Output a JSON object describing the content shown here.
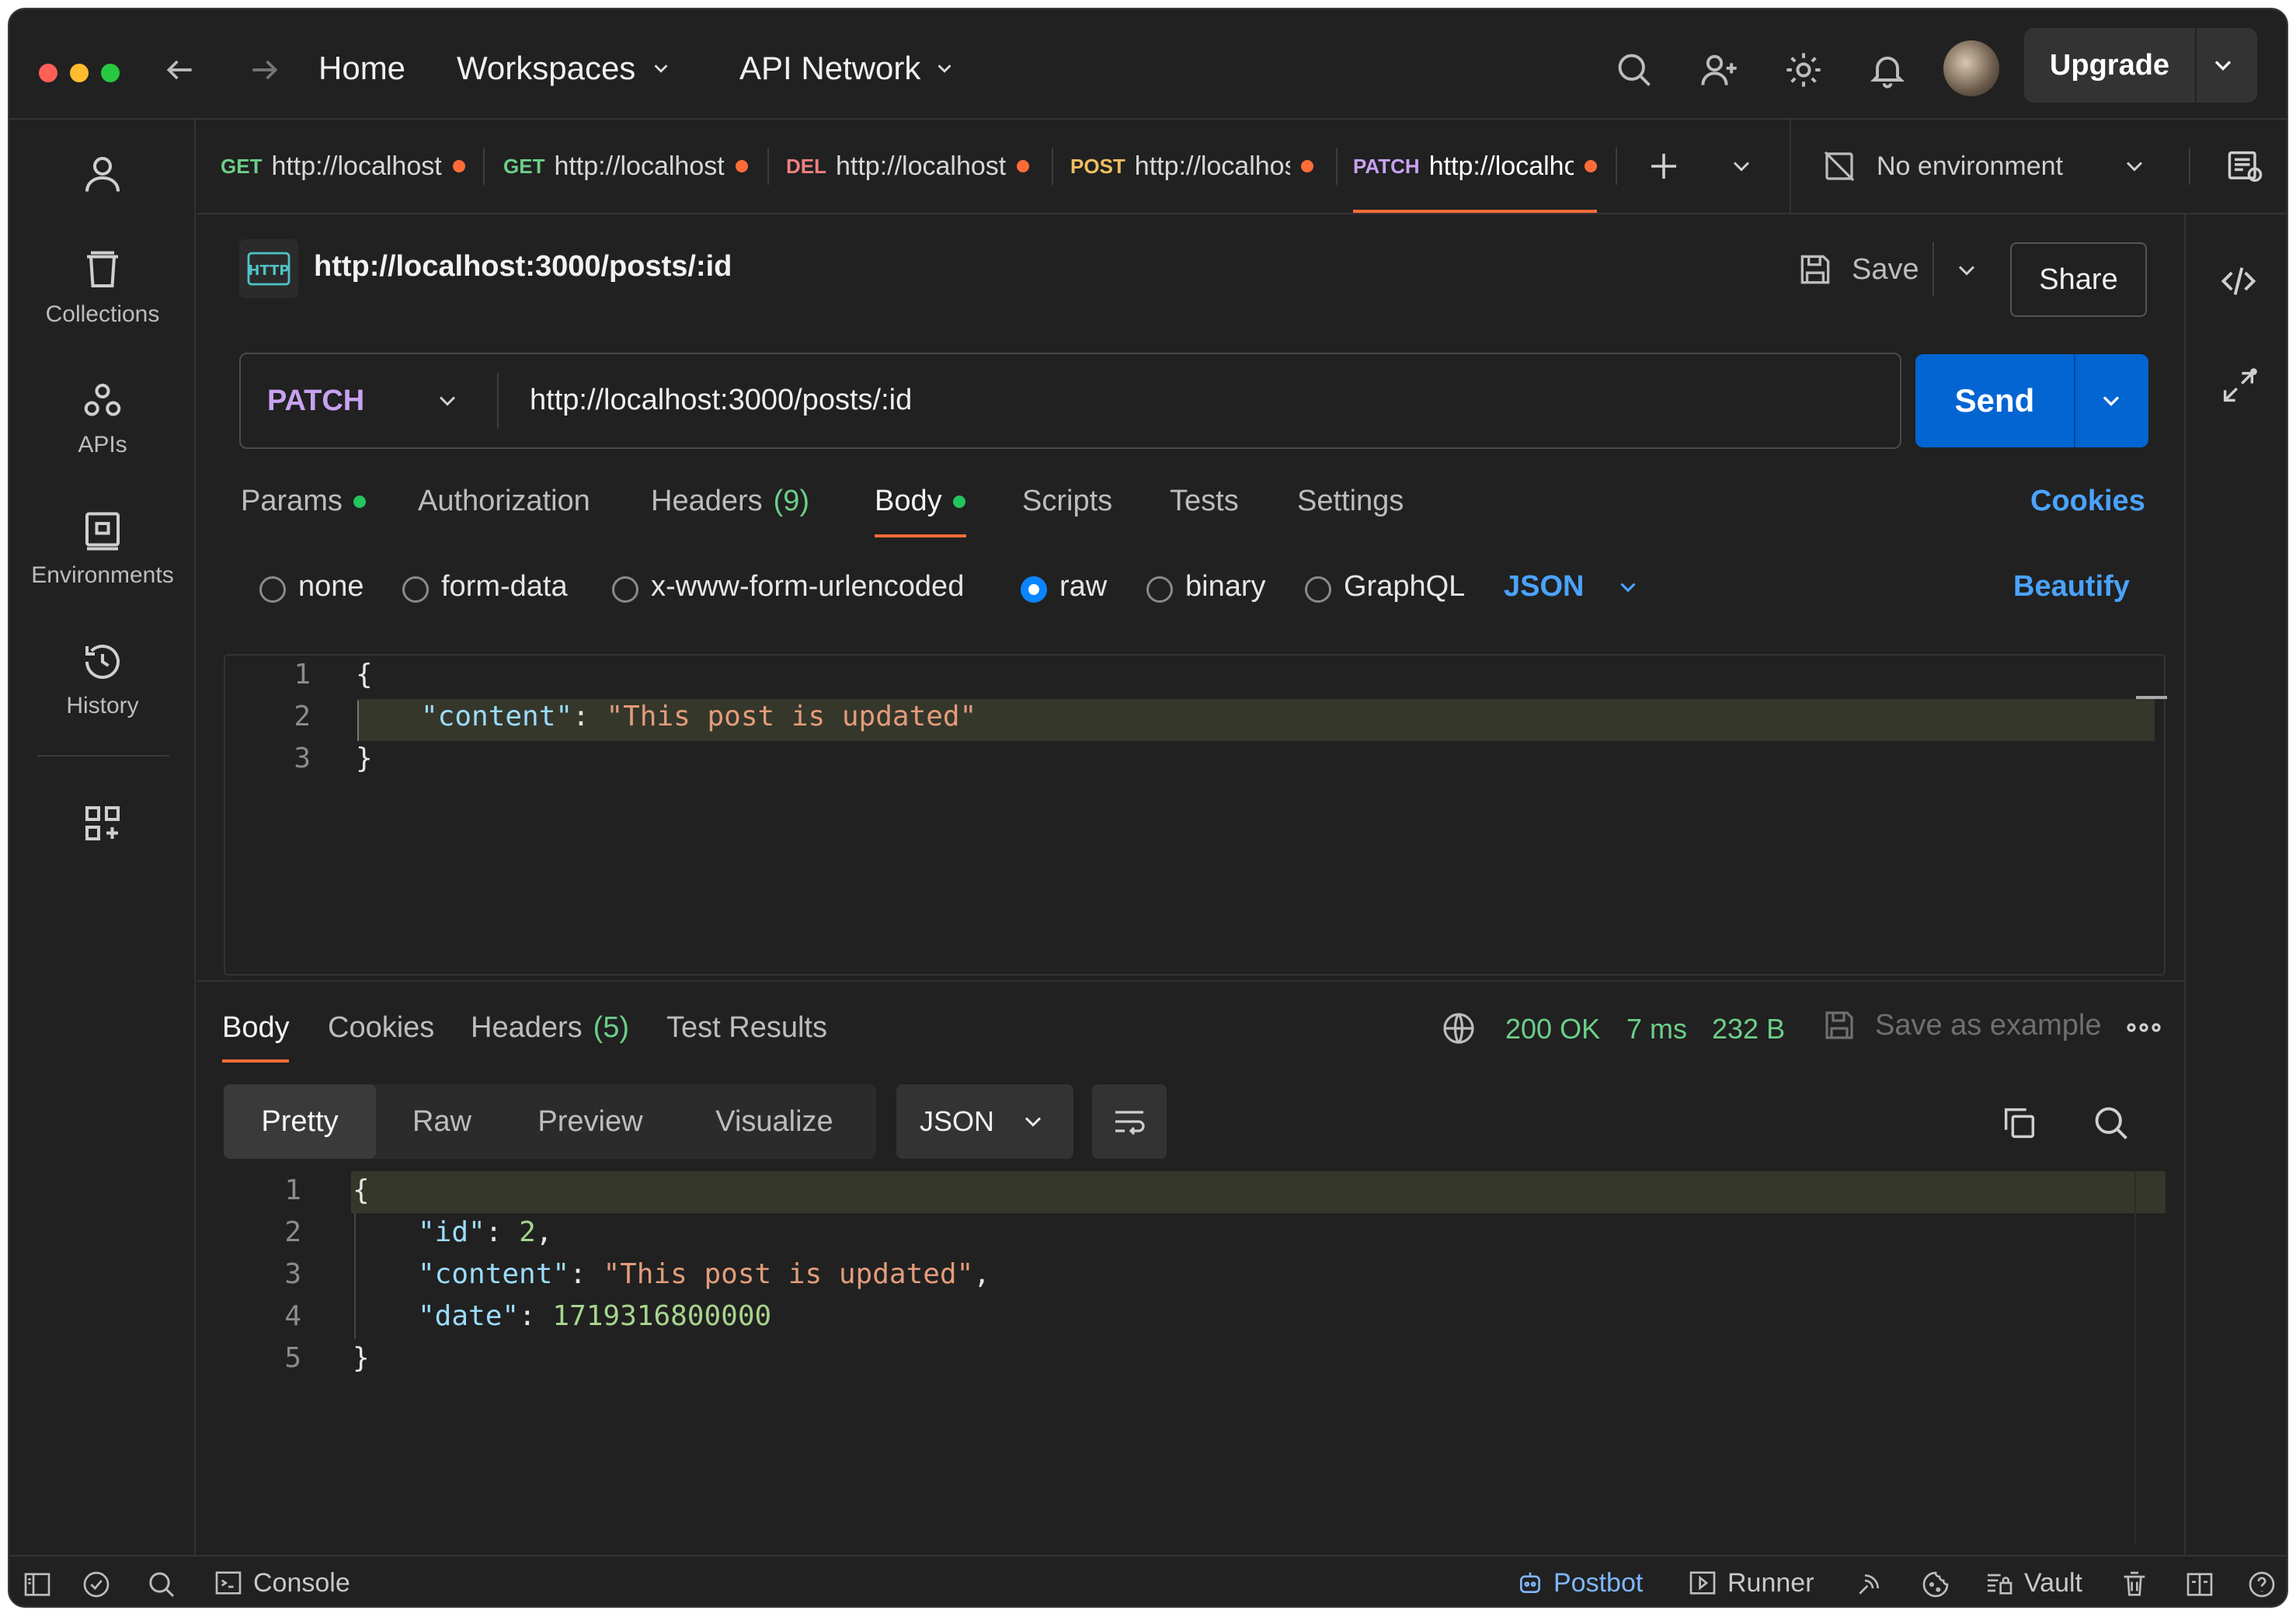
{
  "nav": {
    "home": "Home",
    "workspaces": "Workspaces",
    "api_network": "API Network",
    "upgrade": "Upgrade"
  },
  "sidebar": {
    "items": [
      {
        "label": "",
        "icon": "user-icon"
      },
      {
        "label": "Collections",
        "icon": "trash-bin-icon"
      },
      {
        "label": "APIs",
        "icon": "apis-icon"
      },
      {
        "label": "Environments",
        "icon": "environments-icon"
      },
      {
        "label": "History",
        "icon": "history-icon"
      }
    ]
  },
  "tabs": [
    {
      "method": "GET",
      "url": "http://localhost",
      "color": "#6bcf88"
    },
    {
      "method": "GET",
      "url": "http://localhost",
      "color": "#6bcf88"
    },
    {
      "method": "DEL",
      "url": "http://localhost",
      "color": "#f08080"
    },
    {
      "method": "POST",
      "url": "http://localhost",
      "color": "#f0c060"
    },
    {
      "method": "PATCH",
      "url": "http://localhost",
      "color": "#c8a2f0"
    }
  ],
  "environment": {
    "label": "No environment"
  },
  "request": {
    "title": "http://localhost:3000/posts/:id",
    "save": "Save",
    "share": "Share",
    "method": "PATCH",
    "url": "http://localhost:3000/posts/:id",
    "send": "Send",
    "subtabs": {
      "params": "Params",
      "authorization": "Authorization",
      "headers": "Headers",
      "headers_count": "(9)",
      "body": "Body",
      "scripts": "Scripts",
      "tests": "Tests",
      "settings": "Settings",
      "cookies": "Cookies"
    },
    "body_types": [
      "none",
      "form-data",
      "x-www-form-urlencoded",
      "raw",
      "binary",
      "GraphQL"
    ],
    "format": "JSON",
    "beautify": "Beautify",
    "code": {
      "l1": "{",
      "l2_key": "\"content\"",
      "l2_colon": ": ",
      "l2_val": "\"This post is updated\"",
      "l3": "}"
    }
  },
  "response": {
    "tabs": {
      "body": "Body",
      "cookies": "Cookies",
      "headers": "Headers",
      "headers_count": "(5)",
      "tests": "Test Results"
    },
    "status": "200 OK",
    "time": "7 ms",
    "size": "232 B",
    "save_example": "Save as example",
    "views": {
      "pretty": "Pretty",
      "raw": "Raw",
      "preview": "Preview",
      "visualize": "Visualize",
      "format": "JSON"
    },
    "code": {
      "l1": "{",
      "l2_key": "\"id\"",
      "l2_val": "2",
      "l3_key": "\"content\"",
      "l3_val": "\"This post is updated\"",
      "l4_key": "\"date\"",
      "l4_val": "1719316800000",
      "l5": "}"
    }
  },
  "statusbar": {
    "console": "Console",
    "postbot": "Postbot",
    "runner": "Runner",
    "vault": "Vault"
  },
  "colors": {
    "accent_blue": "#0265d2",
    "link_blue": "#4aa3ff",
    "tab_underline": "#ff6c37",
    "status_green": "#6bcf88"
  }
}
